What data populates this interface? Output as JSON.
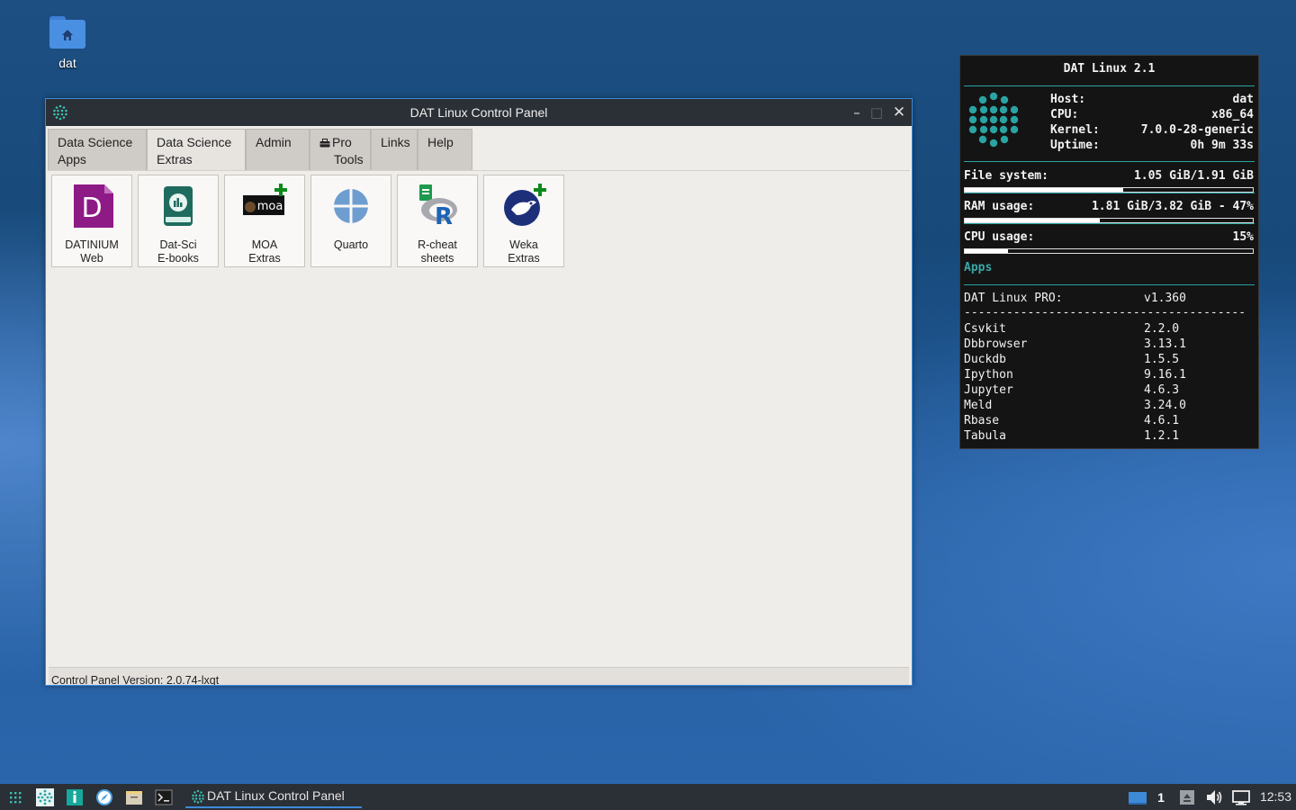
{
  "desktop": {
    "icons": [
      {
        "label": "dat",
        "icon": "home-folder-icon"
      }
    ]
  },
  "window": {
    "title": "DAT Linux Control Panel",
    "controls": [
      "minimize",
      "maximize",
      "close"
    ],
    "tabs": [
      {
        "line1": "Data Science",
        "line2": "Apps",
        "active": false
      },
      {
        "line1": "Data Science",
        "line2": "Extras",
        "active": true
      },
      {
        "line1": "Admin",
        "line2": "",
        "active": false
      },
      {
        "line1": "Pro",
        "line2": "Tools",
        "active": false,
        "icon": "toolbox-icon"
      },
      {
        "line1": "Links",
        "line2": "",
        "active": false
      },
      {
        "line1": "Help",
        "line2": "",
        "active": false
      }
    ],
    "tiles": [
      {
        "line1": "DATINIUM",
        "line2": "Web",
        "icon": "datinium-icon"
      },
      {
        "line1": "Dat-Sci",
        "line2": "E-books",
        "icon": "ebook-icon"
      },
      {
        "line1": "MOA",
        "line2": "Extras",
        "icon": "moa-icon"
      },
      {
        "line1": "Quarto",
        "line2": "",
        "icon": "quarto-icon"
      },
      {
        "line1": "R-cheat",
        "line2": "sheets",
        "icon": "r-cheatsheet-icon"
      },
      {
        "line1": "Weka",
        "line2": "Extras",
        "icon": "weka-icon"
      }
    ],
    "status": "Control Panel Version: 2.0.74-lxqt"
  },
  "conky": {
    "title": "DAT Linux 2.1",
    "info": [
      {
        "key": "Host:",
        "value": "dat"
      },
      {
        "key": "CPU:",
        "value": "x86_64"
      },
      {
        "key": "Kernel:",
        "value": "7.0.0-28-generic"
      },
      {
        "key": "Uptime:",
        "value": "0h 9m 33s"
      }
    ],
    "filesystem": {
      "label": "File system:",
      "value": "1.05 GiB/1.91 GiB",
      "fraction": 0.55
    },
    "ram": {
      "label": "RAM usage:",
      "value": "1.81 GiB/3.82 GiB - 47%",
      "fraction": 0.47
    },
    "cpu": {
      "label": "CPU usage:",
      "value": "15%",
      "fraction": 0.15
    },
    "apps_heading": "Apps",
    "pro": {
      "label": "DAT Linux PRO:",
      "version": "v1.360"
    },
    "dashes": "----------------------------------------",
    "apps": [
      {
        "name": "Csvkit",
        "version": "2.2.0"
      },
      {
        "name": "Dbbrowser",
        "version": "3.13.1"
      },
      {
        "name": "Duckdb",
        "version": "1.5.5"
      },
      {
        "name": "Ipython",
        "version": "9.16.1"
      },
      {
        "name": "Jupyter",
        "version": "4.6.3"
      },
      {
        "name": "Meld",
        "version": "3.24.0"
      },
      {
        "name": "Rbase",
        "version": "4.6.1"
      },
      {
        "name": "Tabula",
        "version": "1.2.1"
      }
    ],
    "accent_color": "#2aa3a3"
  },
  "taskbar": {
    "launchers": [
      "app-menu-icon",
      "control-panel-icon",
      "text-editor-icon",
      "browser-icon",
      "file-manager-icon",
      "terminal-icon"
    ],
    "task": {
      "label": "DAT Linux Control Panel",
      "icon": "control-panel-icon"
    },
    "workspace": "1",
    "clock": "12:53"
  }
}
